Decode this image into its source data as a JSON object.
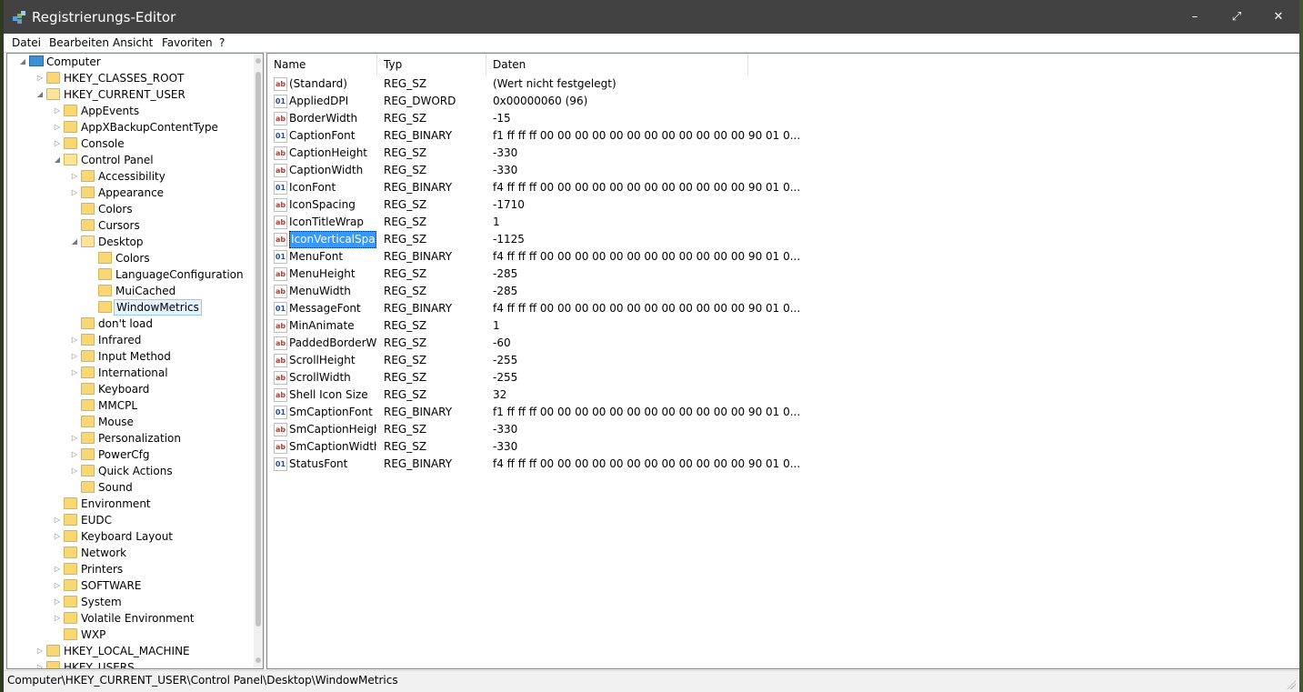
{
  "window": {
    "title": "Registrierungs-Editor",
    "minimize": "–",
    "maximize": "⤢",
    "close": "✕"
  },
  "menu": [
    "Datei",
    "Bearbeiten",
    "Ansicht",
    "Favoriten",
    "?"
  ],
  "tree": [
    {
      "label": "Computer",
      "level": 0,
      "expander": "expanded",
      "icon": "computer-icon"
    },
    {
      "label": "HKEY_CLASSES_ROOT",
      "level": 1,
      "expander": "collapsed"
    },
    {
      "label": "HKEY_CURRENT_USER",
      "level": 1,
      "expander": "expanded"
    },
    {
      "label": "AppEvents",
      "level": 2,
      "expander": "collapsed"
    },
    {
      "label": "AppXBackupContentType",
      "level": 2,
      "expander": "collapsed"
    },
    {
      "label": "Console",
      "level": 2,
      "expander": "collapsed"
    },
    {
      "label": "Control Panel",
      "level": 2,
      "expander": "expanded"
    },
    {
      "label": "Accessibility",
      "level": 3,
      "expander": "collapsed"
    },
    {
      "label": "Appearance",
      "level": 3,
      "expander": "collapsed"
    },
    {
      "label": "Colors",
      "level": 3,
      "expander": "none"
    },
    {
      "label": "Cursors",
      "level": 3,
      "expander": "none"
    },
    {
      "label": "Desktop",
      "level": 3,
      "expander": "expanded"
    },
    {
      "label": "Colors",
      "level": 4,
      "expander": "none"
    },
    {
      "label": "LanguageConfiguration",
      "level": 4,
      "expander": "none"
    },
    {
      "label": "MuiCached",
      "level": 4,
      "expander": "none"
    },
    {
      "label": "WindowMetrics",
      "level": 4,
      "expander": "none",
      "selected": true
    },
    {
      "label": "don't load",
      "level": 3,
      "expander": "none"
    },
    {
      "label": "Infrared",
      "level": 3,
      "expander": "collapsed"
    },
    {
      "label": "Input Method",
      "level": 3,
      "expander": "collapsed"
    },
    {
      "label": "International",
      "level": 3,
      "expander": "collapsed"
    },
    {
      "label": "Keyboard",
      "level": 3,
      "expander": "none"
    },
    {
      "label": "MMCPL",
      "level": 3,
      "expander": "none"
    },
    {
      "label": "Mouse",
      "level": 3,
      "expander": "none"
    },
    {
      "label": "Personalization",
      "level": 3,
      "expander": "collapsed"
    },
    {
      "label": "PowerCfg",
      "level": 3,
      "expander": "collapsed"
    },
    {
      "label": "Quick Actions",
      "level": 3,
      "expander": "collapsed"
    },
    {
      "label": "Sound",
      "level": 3,
      "expander": "none"
    },
    {
      "label": "Environment",
      "level": 2,
      "expander": "none"
    },
    {
      "label": "EUDC",
      "level": 2,
      "expander": "collapsed"
    },
    {
      "label": "Keyboard Layout",
      "level": 2,
      "expander": "collapsed"
    },
    {
      "label": "Network",
      "level": 2,
      "expander": "none"
    },
    {
      "label": "Printers",
      "level": 2,
      "expander": "collapsed"
    },
    {
      "label": "SOFTWARE",
      "level": 2,
      "expander": "collapsed"
    },
    {
      "label": "System",
      "level": 2,
      "expander": "collapsed"
    },
    {
      "label": "Volatile Environment",
      "level": 2,
      "expander": "collapsed"
    },
    {
      "label": "WXP",
      "level": 2,
      "expander": "none"
    },
    {
      "label": "HKEY_LOCAL_MACHINE",
      "level": 1,
      "expander": "collapsed"
    },
    {
      "label": "HKEY_USERS",
      "level": 1,
      "expander": "collapsed"
    }
  ],
  "columns": {
    "name": "Name",
    "type": "Typ",
    "data": "Daten"
  },
  "values": [
    {
      "name": "(Standard)",
      "type": "REG_SZ",
      "data": "(Wert nicht festgelegt)",
      "icon": "ab"
    },
    {
      "name": "AppliedDPI",
      "type": "REG_DWORD",
      "data": "0x00000060 (96)",
      "icon": "bin"
    },
    {
      "name": "BorderWidth",
      "type": "REG_SZ",
      "data": "-15",
      "icon": "ab"
    },
    {
      "name": "CaptionFont",
      "type": "REG_BINARY",
      "data": "f1 ff ff ff 00 00 00 00 00 00 00 00 00 00 00 00 90 01 0...",
      "icon": "bin"
    },
    {
      "name": "CaptionHeight",
      "type": "REG_SZ",
      "data": "-330",
      "icon": "ab"
    },
    {
      "name": "CaptionWidth",
      "type": "REG_SZ",
      "data": "-330",
      "icon": "ab"
    },
    {
      "name": "IconFont",
      "type": "REG_BINARY",
      "data": "f4 ff ff ff 00 00 00 00 00 00 00 00 00 00 00 00 90 01 0...",
      "icon": "bin"
    },
    {
      "name": "IconSpacing",
      "type": "REG_SZ",
      "data": "-1710",
      "icon": "ab"
    },
    {
      "name": "IconTitleWrap",
      "type": "REG_SZ",
      "data": "1",
      "icon": "ab"
    },
    {
      "name": "IconVerticalSpac...",
      "type": "REG_SZ",
      "data": "-1125",
      "icon": "ab",
      "selected": true
    },
    {
      "name": "MenuFont",
      "type": "REG_BINARY",
      "data": "f4 ff ff ff 00 00 00 00 00 00 00 00 00 00 00 00 90 01 0...",
      "icon": "bin"
    },
    {
      "name": "MenuHeight",
      "type": "REG_SZ",
      "data": "-285",
      "icon": "ab"
    },
    {
      "name": "MenuWidth",
      "type": "REG_SZ",
      "data": "-285",
      "icon": "ab"
    },
    {
      "name": "MessageFont",
      "type": "REG_BINARY",
      "data": "f4 ff ff ff 00 00 00 00 00 00 00 00 00 00 00 00 90 01 0...",
      "icon": "bin"
    },
    {
      "name": "MinAnimate",
      "type": "REG_SZ",
      "data": "1",
      "icon": "ab"
    },
    {
      "name": "PaddedBorderW...",
      "type": "REG_SZ",
      "data": "-60",
      "icon": "ab"
    },
    {
      "name": "ScrollHeight",
      "type": "REG_SZ",
      "data": "-255",
      "icon": "ab"
    },
    {
      "name": "ScrollWidth",
      "type": "REG_SZ",
      "data": "-255",
      "icon": "ab"
    },
    {
      "name": "Shell Icon Size",
      "type": "REG_SZ",
      "data": "32",
      "icon": "ab"
    },
    {
      "name": "SmCaptionFont",
      "type": "REG_BINARY",
      "data": "f1 ff ff ff 00 00 00 00 00 00 00 00 00 00 00 00 90 01 0...",
      "icon": "bin"
    },
    {
      "name": "SmCaptionHeight",
      "type": "REG_SZ",
      "data": "-330",
      "icon": "ab"
    },
    {
      "name": "SmCaptionWidth",
      "type": "REG_SZ",
      "data": "-330",
      "icon": "ab"
    },
    {
      "name": "StatusFont",
      "type": "REG_BINARY",
      "data": "f4 ff ff ff 00 00 00 00 00 00 00 00 00 00 00 00 90 01 0...",
      "icon": "bin"
    }
  ],
  "status": {
    "path": "Computer\\HKEY_CURRENT_USER\\Control Panel\\Desktop\\WindowMetrics"
  },
  "colors": {
    "titlebar": "#424242",
    "selection": "#3399ff",
    "folder": "#f8d776"
  }
}
